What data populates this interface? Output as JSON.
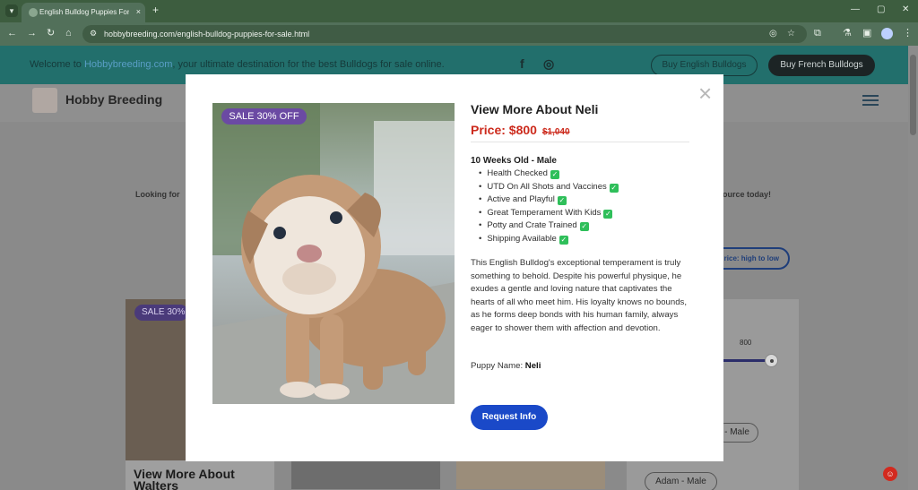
{
  "browser": {
    "tab_title": "English Bulldog Puppies For Sa",
    "tab_close": "×",
    "new_tab": "+",
    "url": "hobbybreeding.com/english-bulldog-puppies-for-sale.html",
    "icons": [
      "tab-menu-icon",
      "back-icon",
      "forward-icon",
      "reload-icon",
      "home-icon",
      "site-info-icon",
      "eye-off-icon",
      "star-icon",
      "extensions-icon",
      "lab-icon",
      "sidebar-icon",
      "profile-icon",
      "kebab-menu-icon"
    ]
  },
  "topbar": {
    "welcome_pre": "Welcome to ",
    "welcome_link": "Hobbybreeding.com",
    "welcome_post": ", your ultimate destination for the best Bulldogs for sale online.",
    "buy_english": "Buy English Bulldogs",
    "buy_french": "Buy French Bulldogs"
  },
  "header": {
    "brand": "Hobby Breeding"
  },
  "background": {
    "looking": "Looking for",
    "source": "ource today!",
    "sort": "rice: high to low",
    "card_badge": "SALE 30%",
    "card_title": "View More About Walters",
    "range_value": "800",
    "chip1": "- Male",
    "chip2": "Adam - Male"
  },
  "modal": {
    "close": "×",
    "sale_badge": "SALE 30% OFF",
    "title": "View More About Neli",
    "price": "Price: $800",
    "price_old": "$1,040",
    "age": "10 Weeks Old - Male",
    "features": [
      "Health Checked",
      "UTD On All Shots and Vaccines",
      "Active and Playful",
      "Great Temperament With Kids",
      "Potty and Crate Trained",
      "Shipping Available"
    ],
    "description": "This English Bulldog's exceptional temperament is truly something to behold. Despite his powerful physique, he exudes a gentle and loving nature that captivates the hearts of all who meet him. His loyalty knows no bounds, as he forms deep bonds with his human family, always eager to shower them with affection and devotion.",
    "puppy_name_label": "Puppy Name: ",
    "puppy_name": "Neli",
    "request_button": "Request Info"
  },
  "colors": {
    "topbar": "#226f6c",
    "price": "#cc2a1c",
    "badge": "#6b4aa3",
    "request": "#1a49c8",
    "check": "#2fbf5a"
  }
}
